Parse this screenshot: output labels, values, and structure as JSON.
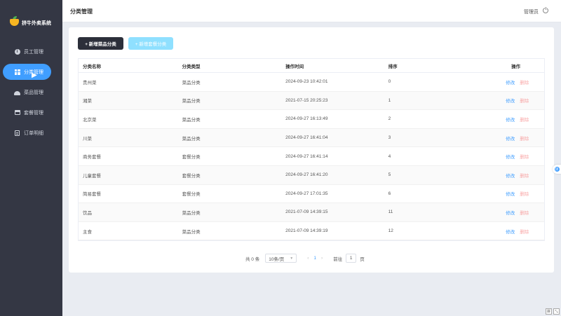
{
  "app": {
    "logo_text": "拼牛外卖系统"
  },
  "sidebar": {
    "items": [
      {
        "label": "员工管理",
        "icon": "info-icon",
        "active": false
      },
      {
        "label": "分类管理",
        "icon": "grid-icon",
        "active": true
      },
      {
        "label": "菜品管理",
        "icon": "dish-icon",
        "active": false
      },
      {
        "label": "套餐管理",
        "icon": "box-icon",
        "active": false
      },
      {
        "label": "订单明细",
        "icon": "doc-icon",
        "active": false
      }
    ]
  },
  "header": {
    "title": "分类管理",
    "user": "管理员",
    "logout_icon": "power-icon"
  },
  "toolbar": {
    "add_dish_category": "+ 新增菜品分类",
    "add_combo_category": "+ 新增套餐分类"
  },
  "table": {
    "headers": [
      "分类名称",
      "分类类型",
      "操作时间",
      "排序",
      "操作"
    ],
    "edit_label": "修改",
    "delete_label": "删除",
    "rows": [
      {
        "name": "贵州菜",
        "type": "菜品分类",
        "time": "2024-09-23 10:42:01",
        "sort": "0"
      },
      {
        "name": "湘菜",
        "type": "菜品分类",
        "time": "2021-07-15 20:25:23",
        "sort": "1"
      },
      {
        "name": "北京菜",
        "type": "菜品分类",
        "time": "2024-09-27 16:13:49",
        "sort": "2"
      },
      {
        "name": "川菜",
        "type": "菜品分类",
        "time": "2024-09-27 16:41:04",
        "sort": "3"
      },
      {
        "name": "商务套餐",
        "type": "套餐分类",
        "time": "2024-09-27 16:41:14",
        "sort": "4"
      },
      {
        "name": "儿童套餐",
        "type": "套餐分类",
        "time": "2024-09-27 16:41:20",
        "sort": "5"
      },
      {
        "name": "简易套餐",
        "type": "套餐分类",
        "time": "2024-09-27 17:01:35",
        "sort": "6"
      },
      {
        "name": "饮品",
        "type": "菜品分类",
        "time": "2021-07-09 14:39:15",
        "sort": "11"
      },
      {
        "name": "主食",
        "type": "菜品分类",
        "time": "2021-07-09 14:39:19",
        "sort": "12"
      }
    ]
  },
  "pagination": {
    "total": "共 0 条",
    "page_size": "10条/页",
    "prev": "‹",
    "current": "1",
    "next": "›",
    "jump_prefix": "前往",
    "jump_value": "1",
    "jump_suffix": "页"
  },
  "widgets": {
    "side_tab": "译",
    "corner_a": "拼",
    "corner_b": "⤡"
  },
  "colors": {
    "primary": "#409eff",
    "sidebar_bg": "#343744",
    "danger": "#f56c6c",
    "dark_button": "#2c2f3a"
  }
}
